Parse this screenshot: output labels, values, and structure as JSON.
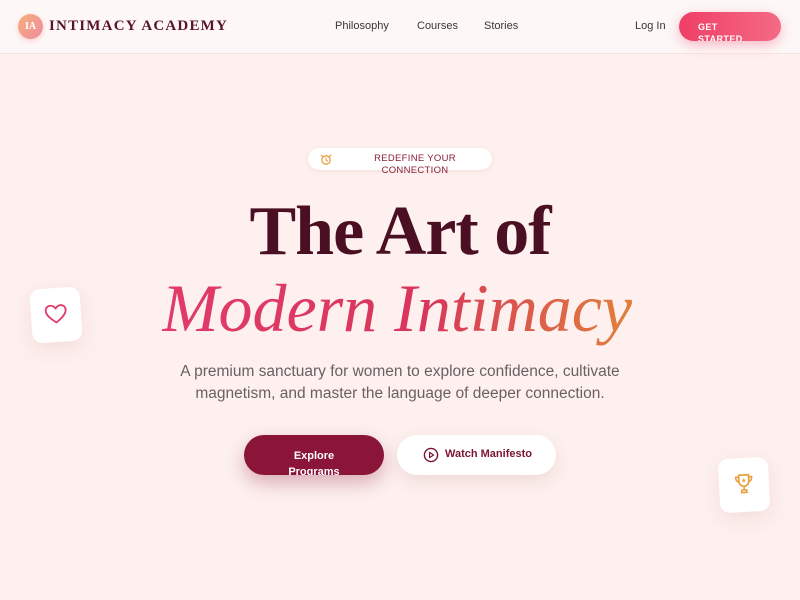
{
  "brand": {
    "logo_initials": "IA",
    "name": "INTIMACY ACADEMY"
  },
  "nav": {
    "links": [
      "Philosophy",
      "Courses",
      "Stories"
    ],
    "login": "Log In",
    "cta": "GET STARTED"
  },
  "badge": {
    "icon": "sparkle-clock-icon",
    "text": "REDEFINE YOUR CONNECTION"
  },
  "hero": {
    "title_line1": "The Art of",
    "title_line2": "Modern Intimacy",
    "subtitle": "A premium sanctuary for women to explore confidence, cultivate magnetism, and master the language of deeper connection."
  },
  "buttons": {
    "primary": "Explore Programs",
    "secondary": "Watch Manifesto",
    "secondary_icon": "play-circle-icon"
  },
  "floating": {
    "left_icon": "heart-icon",
    "right_icon": "trophy-icon"
  },
  "colors": {
    "background": "#fdf0ee",
    "brand_dark": "#4a0f22",
    "accent_pink": "#ef3f66",
    "primary_button": "#8a1538",
    "gradient_end": "#e0823a"
  }
}
